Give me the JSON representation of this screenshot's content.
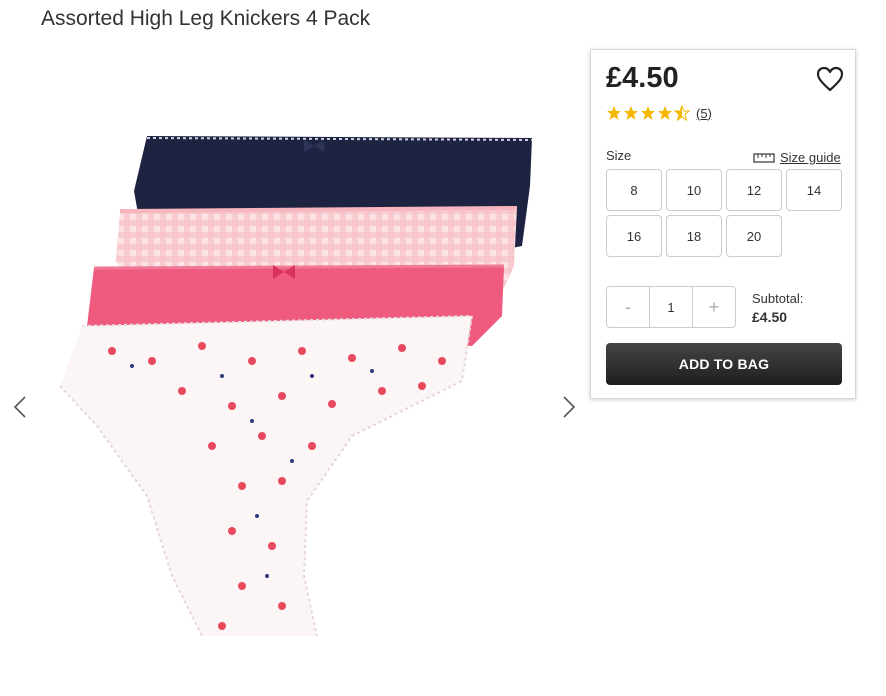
{
  "product": {
    "title": "Assorted High Leg Knickers 4 Pack",
    "price": "£4.50",
    "rating": 4.5,
    "rating_max": 5,
    "reviews_count": "(5)"
  },
  "sizes": {
    "label": "Size",
    "guide_label": "Size guide",
    "options": [
      "8",
      "10",
      "12",
      "14",
      "16",
      "18",
      "20"
    ]
  },
  "quantity": {
    "minus": "-",
    "value": "1",
    "plus": "+"
  },
  "subtotal": {
    "label": "Subtotal:",
    "amount": "£4.50"
  },
  "actions": {
    "add_to_bag": "ADD TO BAG"
  },
  "colors": {
    "star": "#f5b800",
    "button_dark": "#2b2b2b",
    "navy": "#1e2342",
    "pink": "#ef5b7e",
    "light_pink": "#f7c8cd"
  }
}
